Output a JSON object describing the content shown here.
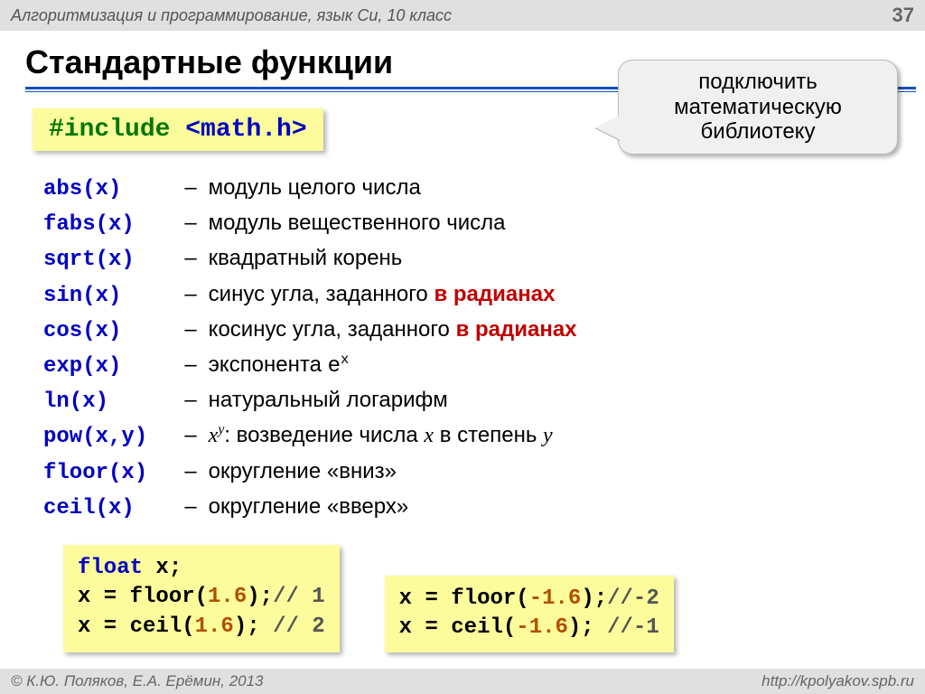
{
  "header": {
    "course": "Алгоритмизация и программирование, язык Си, 10 класс",
    "page_num": "37"
  },
  "title": "Стандартные функции",
  "include": {
    "directive": "#include",
    "header": "<math.h>"
  },
  "callout": {
    "line1": "подключить",
    "line2": "математическую",
    "line3": "библиотеку"
  },
  "functions": [
    {
      "name": "abs(x)",
      "desc_pre": "модуль целого числа",
      "red": "",
      "desc_post": ""
    },
    {
      "name": "fabs(x)",
      "desc_pre": "модуль вещественного числа",
      "red": "",
      "desc_post": ""
    },
    {
      "name": "sqrt(x)",
      "desc_pre": "квадратный корень",
      "red": "",
      "desc_post": ""
    },
    {
      "name": "sin(x)",
      "desc_pre": "синус угла, заданного ",
      "red": "в радианах",
      "desc_post": ""
    },
    {
      "name": "cos(x)",
      "desc_pre": "косинус угла, заданного ",
      "red": "в радианах",
      "desc_post": ""
    },
    {
      "name": "exp(x)",
      "desc_pre": "экспонента ",
      "red": "",
      "desc_post": "",
      "mono": "e",
      "sup": "x"
    },
    {
      "name": "ln(x)",
      "desc_pre": "натуральный логарифм",
      "red": "",
      "desc_post": ""
    },
    {
      "name": "pow(x,y)",
      "desc_pre": "",
      "red": "",
      "desc_post": ": возведение числа ",
      "ital_base": "x",
      "ital_sup": "y",
      "ital2": "x",
      "tail": " в степень ",
      "ital3": "y"
    },
    {
      "name": "floor(x)",
      "desc_pre": "округление «вниз»",
      "red": "",
      "desc_post": ""
    },
    {
      "name": "ceil(x)",
      "desc_pre": "округление «вверх»",
      "red": "",
      "desc_post": ""
    }
  ],
  "code_left": {
    "l1_kw": "float",
    "l1_rest": " x;",
    "l2a": "x = floor(",
    "l2n": "1.6",
    "l2b": ");",
    "l2c": "// 1",
    "l3a": "x = ceil(",
    "l3n": "1.6",
    "l3b": "); ",
    "l3c": "// 2"
  },
  "code_right": {
    "l1a": "x = floor(",
    "l1n": "-1.6",
    "l1b": ");",
    "l1c": "//-2",
    "l2a": "x = ceil(",
    "l2n": "-1.6",
    "l2b": "); ",
    "l2c": "//-1"
  },
  "footer": {
    "copyright": "© К.Ю. Поляков, Е.А. Ерёмин, 2013",
    "url": "http://kpolyakov.spb.ru"
  }
}
